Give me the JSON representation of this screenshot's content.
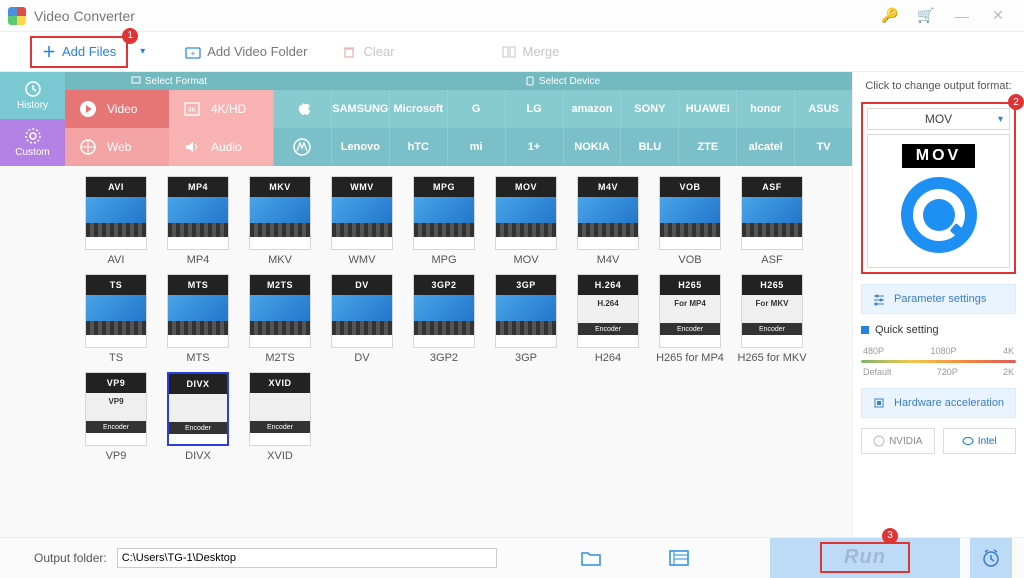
{
  "title": "Video Converter",
  "toolbar": {
    "add_files": "Add Files",
    "add_folder": "Add Video Folder",
    "clear": "Clear",
    "merge": "Merge"
  },
  "callouts": {
    "c1": "1",
    "c2": "2",
    "c3": "3"
  },
  "left": {
    "history": "History",
    "custom": "Custom"
  },
  "tabheads": {
    "format": "Select Format",
    "device": "Select Device"
  },
  "cats": {
    "video": "Video",
    "kh": "4K/HD",
    "web": "Web",
    "audio": "Audio"
  },
  "brands_row1": [
    "",
    "SAMSUNG",
    "Microsoft",
    "G",
    "LG",
    "amazon",
    "SONY",
    "HUAWEI",
    "honor",
    "ASUS"
  ],
  "brands_row2": [
    "",
    "Lenovo",
    "hTC",
    "mi",
    "1+",
    "NOKIA",
    "BLU",
    "ZTE",
    "alcatel",
    "TV"
  ],
  "formats_row1": [
    {
      "code": "AVI",
      "label": "AVI"
    },
    {
      "code": "MP4",
      "label": "MP4"
    },
    {
      "code": "MKV",
      "label": "MKV"
    },
    {
      "code": "WMV",
      "label": "WMV"
    },
    {
      "code": "MPG",
      "label": "MPG"
    },
    {
      "code": "MOV",
      "label": "MOV"
    },
    {
      "code": "M4V",
      "label": "M4V"
    },
    {
      "code": "VOB",
      "label": "VOB"
    },
    {
      "code": "ASF",
      "label": "ASF"
    },
    {
      "code": "TS",
      "label": "TS"
    }
  ],
  "formats_row2": [
    {
      "code": "MTS",
      "label": "MTS"
    },
    {
      "code": "M2TS",
      "label": "M2TS"
    },
    {
      "code": "DV",
      "label": "DV"
    },
    {
      "code": "3GP2",
      "label": "3GP2"
    },
    {
      "code": "3GP",
      "label": "3GP"
    },
    {
      "code": "H.264",
      "label": "H264",
      "enc": true,
      "sub": "H.264"
    },
    {
      "code": "H265",
      "label": "H265 for MP4",
      "enc": true,
      "sub": "For MP4"
    },
    {
      "code": "H265",
      "label": "H265 for MKV",
      "enc": true,
      "sub": "For MKV"
    },
    {
      "code": "VP9",
      "label": "VP9",
      "enc": true,
      "sub": "VP9"
    },
    {
      "code": "DIVX",
      "label": "DIVX",
      "enc": true,
      "sel": true
    }
  ],
  "formats_row3": [
    {
      "code": "XVID",
      "label": "XVID",
      "enc": true
    }
  ],
  "right": {
    "header": "Click to change output format:",
    "selected": "MOV",
    "param": "Parameter settings",
    "quick": "Quick setting",
    "marks_top": [
      "480P",
      "1080P",
      "4K"
    ],
    "marks_bot": [
      "Default",
      "720P",
      "2K"
    ],
    "hw": "Hardware acceleration",
    "nvidia": "NVIDIA",
    "intel": "Intel"
  },
  "footer": {
    "label": "Output folder:",
    "path": "C:\\Users\\TG-1\\Desktop",
    "run": "Run"
  }
}
